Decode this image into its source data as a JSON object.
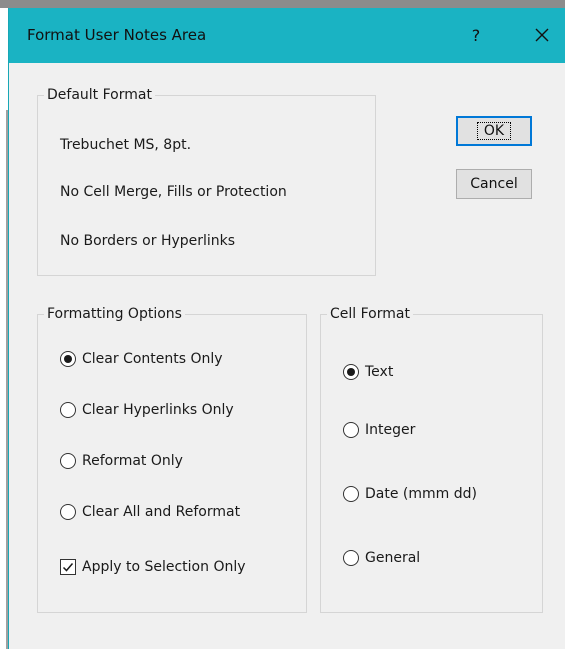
{
  "dialog": {
    "title": "Format User Notes Area",
    "help_glyph": "?"
  },
  "default_format": {
    "legend": "Default Format",
    "lines": [
      "Trebuchet MS, 8pt.",
      "No Cell Merge, Fills or Protection",
      "No Borders or Hyperlinks"
    ]
  },
  "buttons": {
    "ok": "OK",
    "cancel": "Cancel"
  },
  "formatting_options": {
    "legend": "Formatting Options",
    "options": [
      {
        "label": "Clear Contents Only",
        "selected": true
      },
      {
        "label": "Clear Hyperlinks Only",
        "selected": false
      },
      {
        "label": "Reformat Only",
        "selected": false
      },
      {
        "label": "Clear All and Reformat",
        "selected": false
      }
    ],
    "apply_selection": {
      "label": "Apply to Selection Only",
      "checked": true
    }
  },
  "cell_format": {
    "legend": "Cell Format",
    "options": [
      {
        "label": "Text",
        "selected": true
      },
      {
        "label": "Integer",
        "selected": false
      },
      {
        "label": "Date (mmm dd)",
        "selected": false
      },
      {
        "label": "General",
        "selected": false
      }
    ]
  },
  "colors": {
    "titlebar": "#1ab3c3",
    "dialog_bg": "#f0f0f0",
    "focus_border": "#0078d7"
  },
  "icons": {
    "close": "close-icon"
  }
}
